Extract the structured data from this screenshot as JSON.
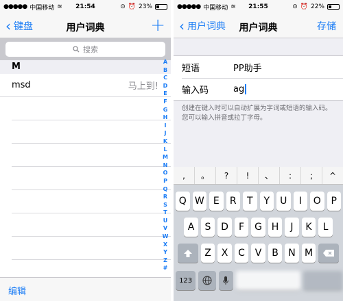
{
  "left": {
    "status": {
      "carrier": "中国移动",
      "time": "21:54",
      "battery": "23%",
      "battery_level": 0.23
    },
    "nav": {
      "back": "键盘",
      "title": "用户词典",
      "add": "+"
    },
    "search": {
      "placeholder": "搜索"
    },
    "section": "M",
    "entries": [
      {
        "shortcut": "msd",
        "phrase": "马上到!"
      }
    ],
    "index_letters": [
      "A",
      "B",
      "C",
      "D",
      "E",
      "F",
      "G",
      "H",
      "I",
      "J",
      "K",
      "L",
      "M",
      "N",
      "O",
      "P",
      "Q",
      "R",
      "S",
      "T",
      "U",
      "V",
      "W",
      "X",
      "Y",
      "Z",
      "#"
    ],
    "toolbar": {
      "edit": "编辑"
    }
  },
  "right": {
    "status": {
      "carrier": "中国移动",
      "time": "21:55",
      "battery": "22%",
      "battery_level": 0.22
    },
    "nav": {
      "back": "用户词典",
      "title": "用户词典",
      "save": "存储"
    },
    "form": {
      "phrase_label": "短语",
      "phrase_value": "PP助手",
      "shortcut_label": "输入码",
      "shortcut_value": "ag"
    },
    "hint": "创建在键入时可以自动扩展为字词或短语的输入码。您可以输入拼音或拉丁字母。",
    "keyboard": {
      "punct": [
        ",",
        "。",
        "?",
        "!",
        "、",
        ":",
        ";",
        "^"
      ],
      "row1": [
        "Q",
        "W",
        "E",
        "R",
        "T",
        "Y",
        "U",
        "I",
        "O",
        "P"
      ],
      "row2": [
        "A",
        "S",
        "D",
        "F",
        "G",
        "H",
        "J",
        "K",
        "L"
      ],
      "row3": [
        "Z",
        "X",
        "C",
        "V",
        "B",
        "N",
        "M"
      ],
      "num_key": "123"
    }
  }
}
